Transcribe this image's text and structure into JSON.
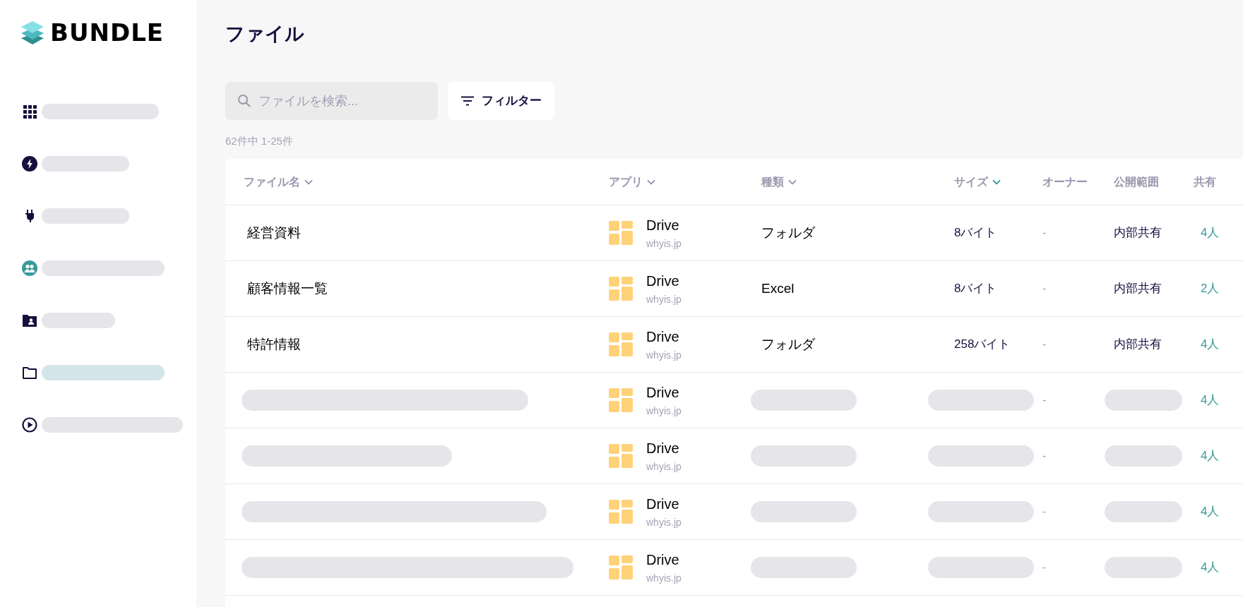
{
  "logo": {
    "text": "BUNDLE"
  },
  "sidebar": {
    "items": [
      {
        "selected": false
      },
      {
        "selected": false
      },
      {
        "selected": false
      },
      {
        "selected": false
      },
      {
        "selected": false
      },
      {
        "selected": true
      },
      {
        "selected": false
      }
    ]
  },
  "page": {
    "title": "ファイル"
  },
  "search": {
    "placeholder": "ファイルを検索..."
  },
  "filter_button": {
    "label": "フィルター"
  },
  "result_count": "62件中 1-25件",
  "table": {
    "columns": [
      {
        "label": "ファイル名",
        "sortable": true,
        "sorted": false
      },
      {
        "label": "アプリ",
        "sortable": true,
        "sorted": false
      },
      {
        "label": "種類",
        "sortable": true,
        "sorted": false
      },
      {
        "label": "サイズ",
        "sortable": true,
        "sorted": true
      },
      {
        "label": "オーナー",
        "sortable": false
      },
      {
        "label": "公開範囲",
        "sortable": false
      },
      {
        "label": "共有",
        "sortable": false
      }
    ],
    "rows": [
      {
        "kind": "loaded",
        "name": "経営資料",
        "app": "Drive",
        "domain": "whyis.jp",
        "type": "フォルダ",
        "size": "8バイト",
        "owner": "-",
        "visibility": "内部共有",
        "shared": "4人"
      },
      {
        "kind": "loaded",
        "name": "顧客情報一覧",
        "app": "Drive",
        "domain": "whyis.jp",
        "type": "Excel",
        "size": "8バイト",
        "owner": "-",
        "visibility": "内部共有",
        "shared": "2人"
      },
      {
        "kind": "loaded",
        "name": "特許情報",
        "app": "Drive",
        "domain": "whyis.jp",
        "type": "フォルダ",
        "size": "258バイト",
        "owner": "-",
        "visibility": "内部共有",
        "shared": "4人"
      },
      {
        "kind": "loading",
        "app": "Drive",
        "domain": "whyis.jp",
        "owner": "-",
        "shared": "4人"
      },
      {
        "kind": "loading",
        "app": "Drive",
        "domain": "whyis.jp",
        "owner": "-",
        "shared": "4人"
      },
      {
        "kind": "loading",
        "app": "Drive",
        "domain": "whyis.jp",
        "owner": "-",
        "shared": "4人"
      },
      {
        "kind": "loading",
        "app": "Drive",
        "domain": "whyis.jp",
        "owner": "-",
        "shared": "4人"
      }
    ]
  }
}
